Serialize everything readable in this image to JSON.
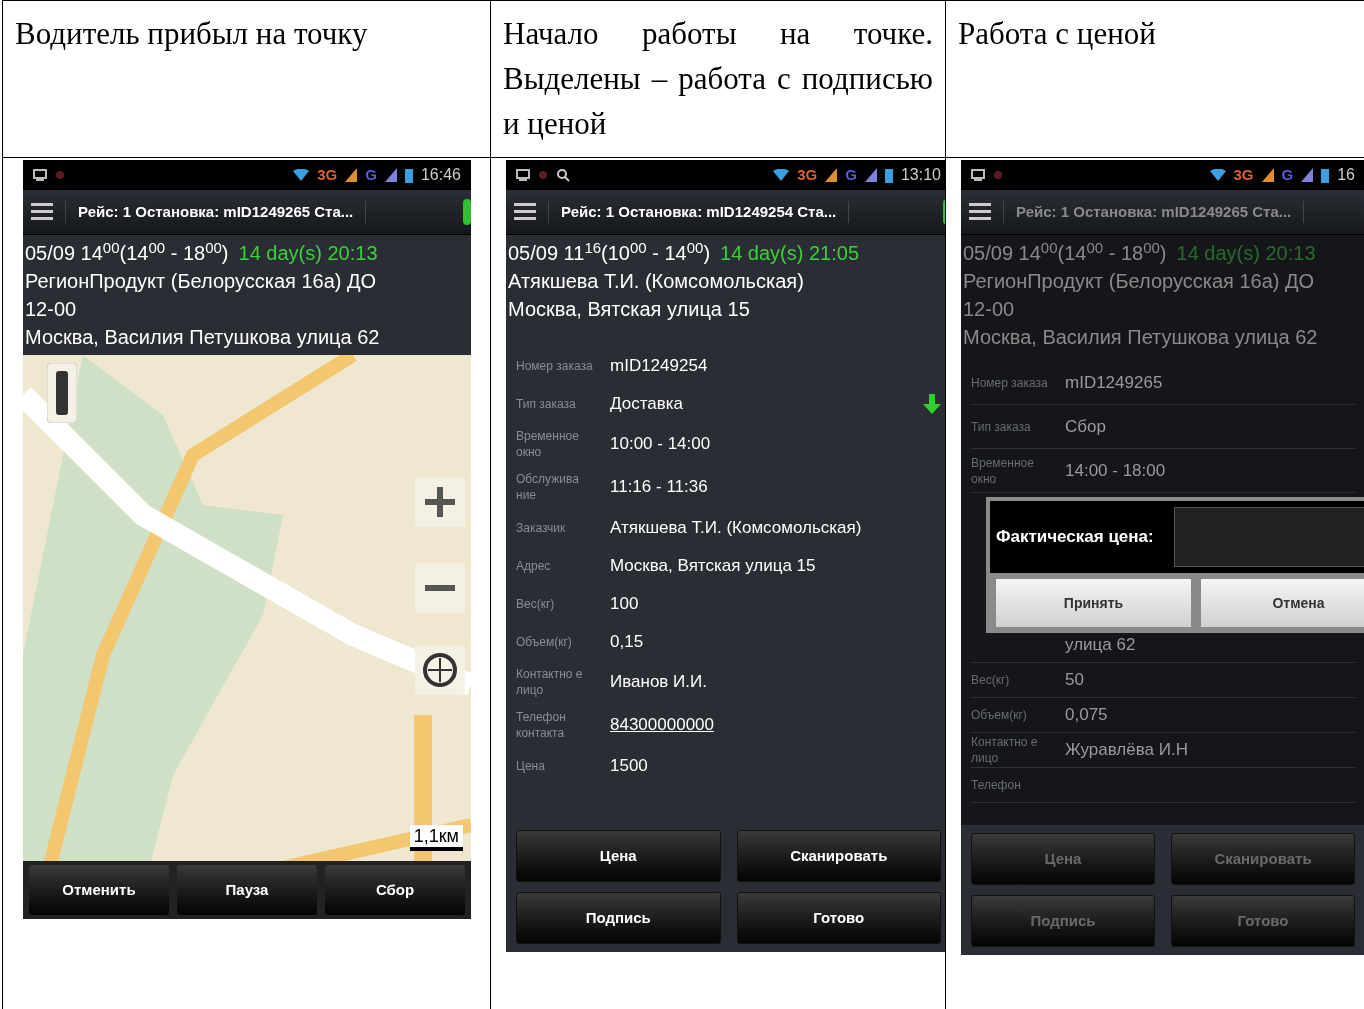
{
  "table": {
    "headers": [
      "Водитель прибыл на точку",
      "Начало работы на точке. Выделены – работа с подписью и ценой",
      "Работа с ценой"
    ]
  },
  "screens": [
    {
      "kind": "map",
      "status": {
        "networks": [
          "3G",
          "G"
        ],
        "time": "16:46"
      },
      "title": "Рейс: 1 Остановка: mID1249265 Ста...",
      "schedule": "05/09 14$^{00}$(14$^{00}$ - 18$^{00}$)",
      "countdown": "14 day(s) 20:13",
      "lines": [
        "РегионПродукт (Белорусская 16а) ДО 12-00",
        "Москва, Василия Петушкова улица 62"
      ],
      "map": {
        "scale": "1,1км"
      },
      "buttons": [
        "Отменить",
        "Пауза",
        "Сбор"
      ]
    },
    {
      "kind": "details",
      "status": {
        "networks": [
          "3G",
          "G"
        ],
        "time": "13:10"
      },
      "title": "Рейс: 1 Остановка: mID1249254 Ста...",
      "schedule": "05/09 11$^{16}$(10$^{00}$ - 14$^{00}$)",
      "countdown": "14 day(s) 21:05",
      "lines": [
        "Атякшева Т.И.  (Комсомольская)",
        "Москва, Вятская улица 15"
      ],
      "fields": [
        {
          "label": "Номер заказа",
          "value": "mID1249254"
        },
        {
          "label": "Тип заказа",
          "value": "Доставка",
          "arrow": true
        },
        {
          "label": "Временное окно",
          "value": "10:00 - 14:00"
        },
        {
          "label": "Обслужива ние",
          "value": "11:16 - 11:36"
        },
        {
          "label": "Заказчик",
          "value": "Атякшева Т.И.  (Комсомольская)"
        },
        {
          "label": "Адрес",
          "value": "Москва, Вятская улица 15"
        },
        {
          "label": "Вес(кг)",
          "value": "100"
        },
        {
          "label": "Объем(кг)",
          "value": "0,15"
        },
        {
          "label": "Контактно е лицо",
          "value": "Иванов И.И."
        },
        {
          "label": "Телефон контакта",
          "value": "84300000000",
          "link": true
        },
        {
          "label": "Цена",
          "value": "1500"
        }
      ],
      "buttons": [
        "Цена",
        "Сканировать",
        "Подпись",
        "Готово"
      ]
    },
    {
      "kind": "dialog",
      "status": {
        "networks": [
          "3G",
          "G"
        ],
        "time": "16"
      },
      "title": "Рейс: 1 Остановка: mID1249265 Ста...",
      "schedule": "05/09 14$^{00}$(14$^{00}$ - 18$^{00}$)",
      "countdown": "14 day(s) 20:13",
      "lines": [
        "РегионПродукт (Белорусская 16а) ДО 12-00",
        "Москва, Василия Петушкова улица 62"
      ],
      "fields": [
        {
          "label": "Номер заказа",
          "value": "mID1249265"
        },
        {
          "label": "Тип заказа",
          "value": "Сбор"
        },
        {
          "label": "Временное окно",
          "value": "14:00 - 18:00"
        }
      ],
      "fields_below": [
        {
          "value": "улица 62"
        },
        {
          "label": "Вес(кг)",
          "value": "50"
        },
        {
          "label": "Объем(кг)",
          "value": "0,075"
        },
        {
          "label": "Контактно е лицо",
          "value": "Журавлёва И.Н"
        },
        {
          "label": "Телефон"
        }
      ],
      "dialog": {
        "label": "Фактическая цена:",
        "buttons": [
          "Принять",
          "Отмена"
        ]
      },
      "buttons": [
        "Цена",
        "Сканировать",
        "Подпись",
        "Готово"
      ]
    }
  ]
}
